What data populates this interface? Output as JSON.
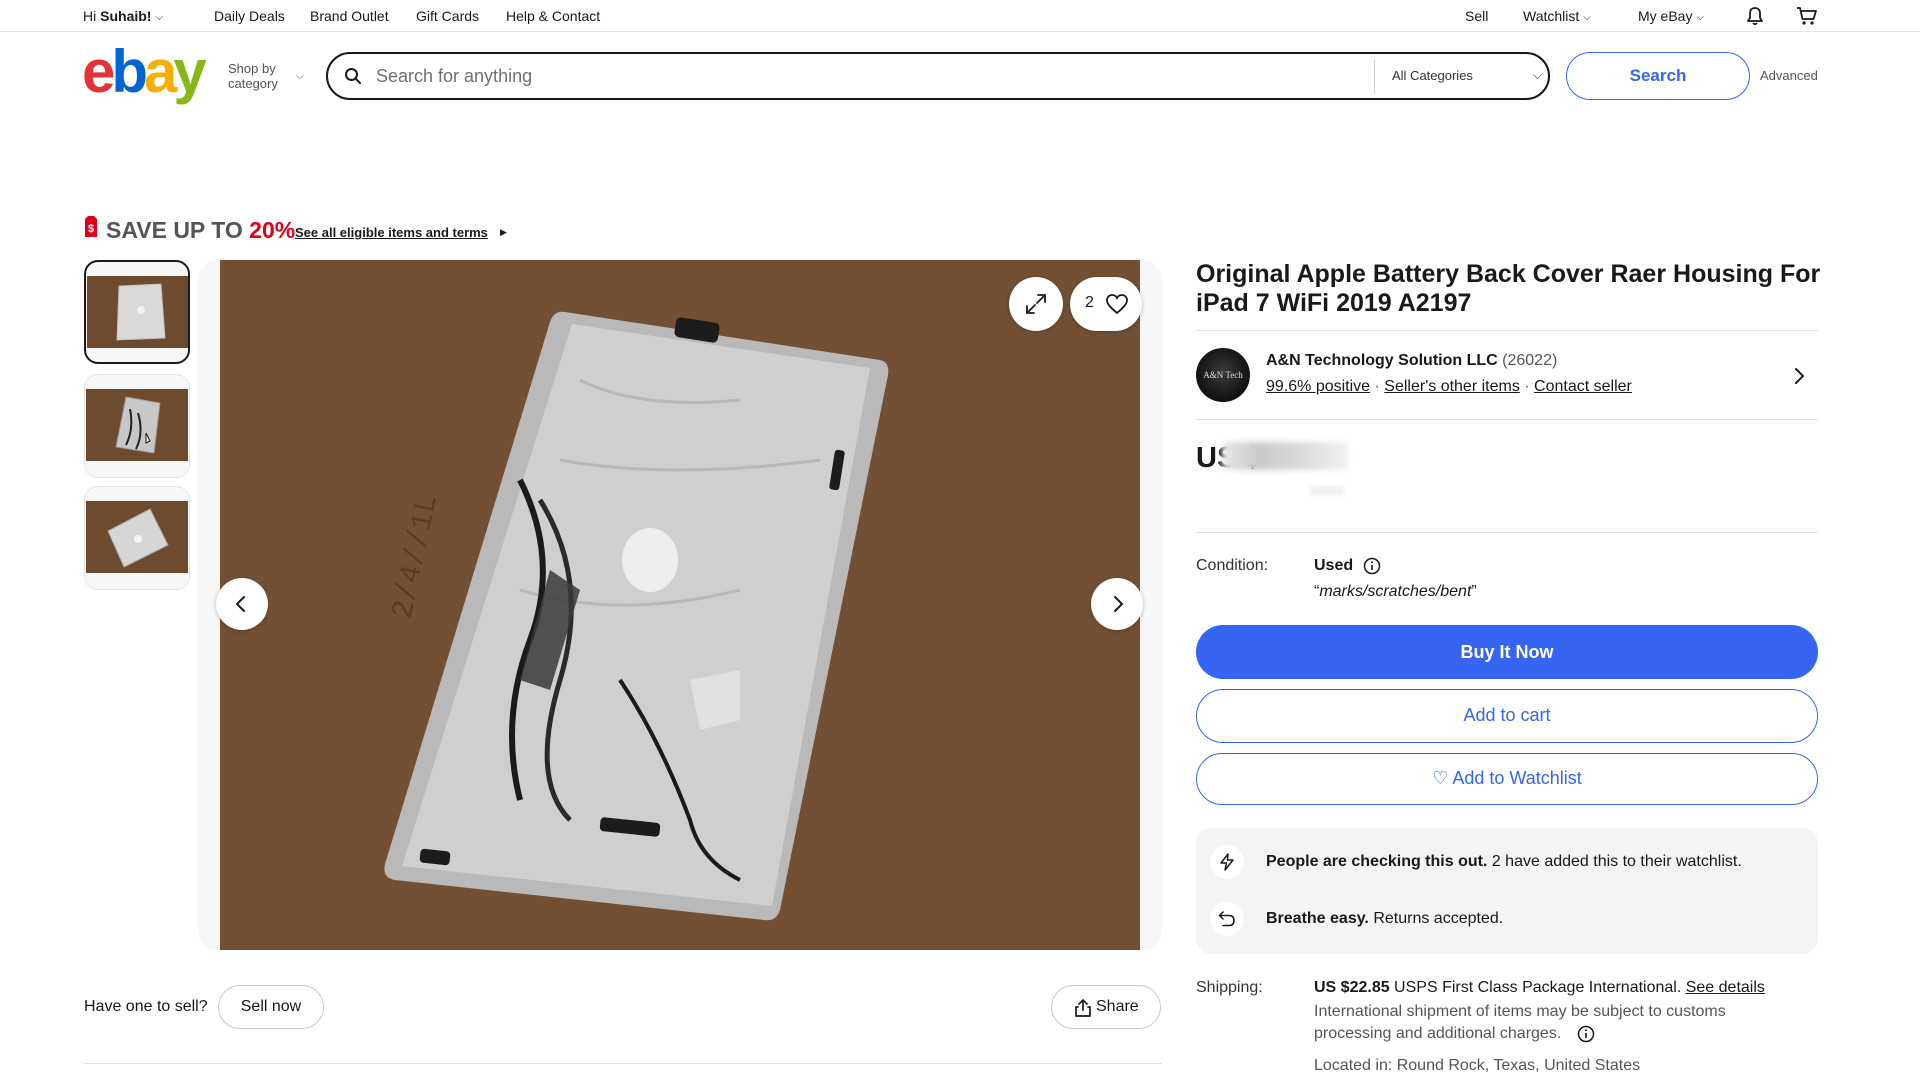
{
  "topbar": {
    "greeting_prefix": "Hi ",
    "greeting_name": "Suhaib!",
    "links": [
      "Daily Deals",
      "Brand Outlet",
      "Gift Cards",
      "Help & Contact"
    ],
    "sell": "Sell",
    "watchlist": "Watchlist",
    "my_ebay": "My eBay"
  },
  "header": {
    "logo": {
      "e": "e",
      "b": "b",
      "a": "a",
      "y": "y"
    },
    "shop_by_line1": "Shop by",
    "shop_by_line2": "category",
    "search_placeholder": "Search for anything",
    "category": "All Categories",
    "search_button": "Search",
    "advanced": "Advanced"
  },
  "promo": {
    "text": "SAVE UP TO ",
    "percent": "20%",
    "link": "See all eligible items and terms"
  },
  "gallery": {
    "thumbnail_count": 3,
    "selected_thumbnail": 1,
    "watch_count": "2"
  },
  "below_image": {
    "have_one": "Have one to sell?",
    "sell_now": "Sell now",
    "share": "Share"
  },
  "item": {
    "title": "Original Apple Battery Back Cover Raer Housing For iPad 7 WiFi 2019 A2197",
    "seller": {
      "avatar_text": "A&N Tech",
      "name": "A&N Technology Solution LLC",
      "feedback_count": "(26022)",
      "positive": "99.6% positive",
      "other_items": "Seller's other items",
      "contact": "Contact seller",
      "separator": " · "
    },
    "price_prefix": "US $",
    "condition": {
      "label": "Condition:",
      "value": "Used",
      "quote_open": "“",
      "description": "marks/scratches/bent",
      "quote_close": "”"
    },
    "buttons": {
      "buy_now": "Buy It Now",
      "add_to_cart": "Add to cart",
      "add_to_watchlist": "Add to Watchlist",
      "watchlist_heart": "♡"
    },
    "urgency": {
      "checking_bold": "People are checking this out.",
      "checking_rest": " 2 have added this to their watchlist.",
      "returns_bold": "Breathe easy.",
      "returns_rest": " Returns accepted."
    },
    "shipping": {
      "label": "Shipping:",
      "price": "US $22.85",
      "service": " USPS First Class Package International. ",
      "see_details": "See details",
      "note_line1": "International shipment of items may be subject to customs",
      "note_line2": "processing and additional charges.",
      "located": "Located in: Round Rock, Texas, United States"
    }
  },
  "colors": {
    "accent_blue": "#3665f3",
    "promo_red": "#e0001b",
    "logo_red": "#e53238",
    "logo_blue": "#0064d2",
    "logo_yellow": "#f5af02",
    "logo_green": "#86b817"
  },
  "icons": [
    "chevron-down-icon",
    "bell-icon",
    "cart-icon",
    "search-icon",
    "tag-icon",
    "expand-icon",
    "heart-icon",
    "chevron-left-icon",
    "chevron-right-icon",
    "share-icon",
    "info-icon",
    "lightning-icon",
    "return-icon"
  ]
}
